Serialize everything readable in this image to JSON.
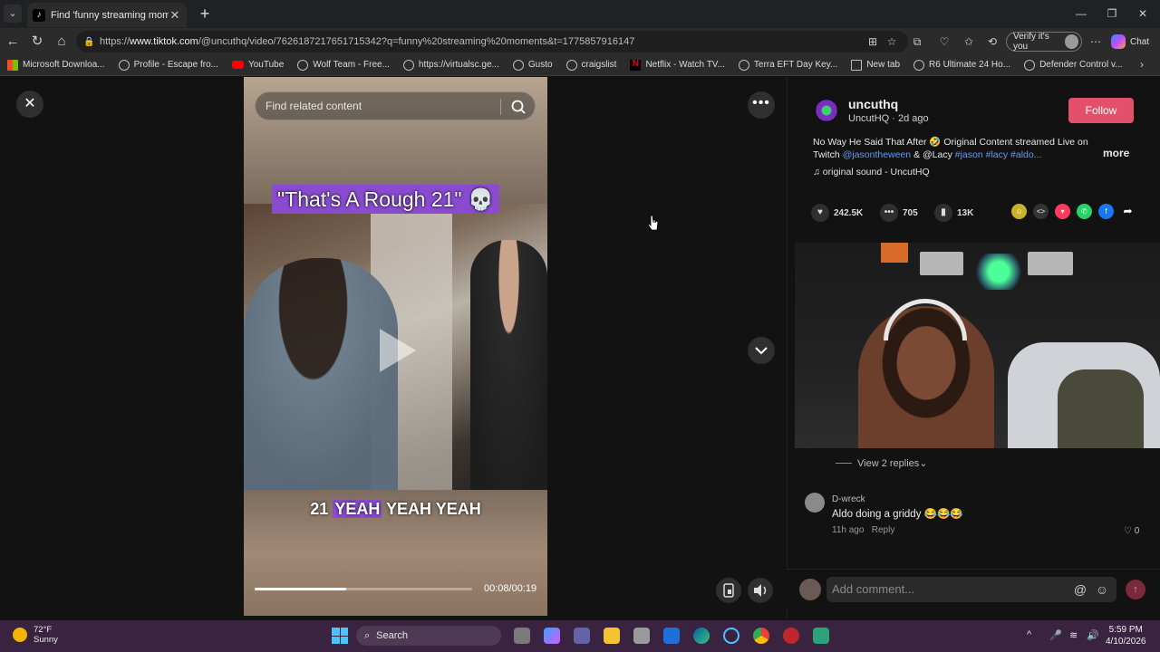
{
  "browser": {
    "tab_title": "Find 'funny streaming moments' o",
    "url_prefix": "https://",
    "url_domain": "www.tiktok.com",
    "url_path": "/@uncuthq/video/7626187217651715342?q=funny%20streaming%20moments&t=1775857916147",
    "verify_label": "Verify it's you",
    "chat_label": "Chat",
    "bookmarks": [
      {
        "label": "Microsoft Downloa...",
        "icon": "microsoft-icon"
      },
      {
        "label": "Profile - Escape fro...",
        "icon": "globe-icon"
      },
      {
        "label": "YouTube",
        "icon": "youtube-icon"
      },
      {
        "label": "Wolf Team - Free...",
        "icon": "globe-icon"
      },
      {
        "label": "https://virtualsc.ge...",
        "icon": "globe-icon"
      },
      {
        "label": "Gusto",
        "icon": "globe-icon"
      },
      {
        "label": "craigslist",
        "icon": "globe-icon"
      },
      {
        "label": "Netflix - Watch TV...",
        "icon": "netflix-icon"
      },
      {
        "label": "Terra EFT Day Key...",
        "icon": "globe-icon"
      },
      {
        "label": "New tab",
        "icon": "newtab-icon"
      },
      {
        "label": "R6 Ultimate 24 Ho...",
        "icon": "globe-icon"
      },
      {
        "label": "Defender Control v...",
        "icon": "globe-icon"
      }
    ]
  },
  "video": {
    "search_placeholder": "Find related content",
    "caption": "\"That's A Rough 21\" 💀",
    "subtitle_plain": "21",
    "subtitle_highlight": "YEAH",
    "subtitle_rest": "YEAH YEAH",
    "time": "00:08/00:19",
    "progress": 0.42
  },
  "post": {
    "username": "uncuthq",
    "subline": "UncutHQ · 2d ago",
    "follow_label": "Follow",
    "desc_text": "No Way He Said That After 🤣 Original Content streamed Live on Twitch ",
    "desc_mention1": "@jasontheween",
    "desc_amp": " & ",
    "desc_mention2": "@Lacy",
    "desc_tags": " #jason #lacy #aldo...",
    "more_label": "more",
    "sound": "original sound - UncutHQ",
    "likes": "242.5K",
    "comments": "705",
    "saves": "13K"
  },
  "comments": {
    "view_replies": "View 2 replies",
    "items": [
      {
        "author": "D-wreck",
        "text": "Aldo doing a griddy 😂😂😂",
        "time": "11h ago",
        "reply_label": "Reply",
        "likes": "0"
      }
    ],
    "input_placeholder": "Add comment..."
  },
  "taskbar": {
    "temp": "72°F",
    "condition": "Sunny",
    "search_label": "Search",
    "time": "5:59 PM",
    "date": "4/10/2026"
  },
  "colors": {
    "follow": "#e3506a",
    "caption_highlight": "#8a4bd0",
    "link": "#5b9bff"
  }
}
